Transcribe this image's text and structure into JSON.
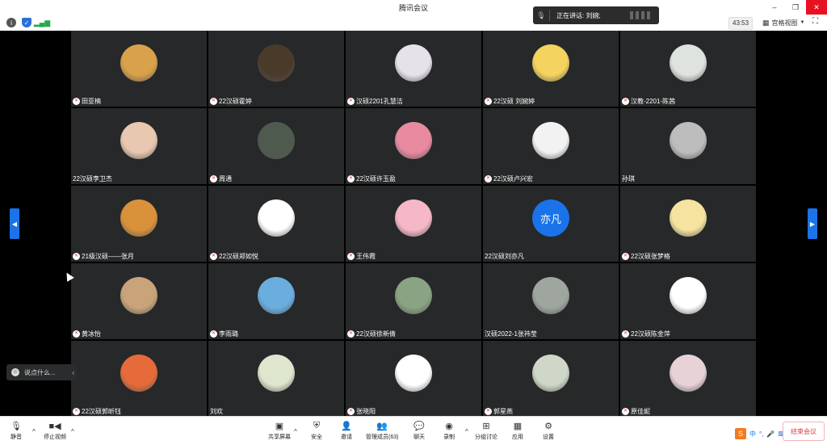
{
  "window": {
    "title": "腾讯会议"
  },
  "window_controls": [
    "–",
    "❐",
    "✕"
  ],
  "topbar": {
    "timer": "43:53",
    "view_label": "宫格视图"
  },
  "speaking": {
    "label": "正在讲话: 刘婉;"
  },
  "participants": [
    {
      "name": "田亚楠",
      "avatar": "cartoon-lion",
      "color": "#d9a24a"
    },
    {
      "name": "22汉硕霍婷",
      "avatar": "dark-photo",
      "color": "#4a3a2a"
    },
    {
      "name": "汉硕2201孔慧洁",
      "avatar": "girl-photo",
      "color": "#e6e2ea"
    },
    {
      "name": "22汉硕 刘婉婷",
      "avatar": "cartoon-duck",
      "color": "#f4d35e"
    },
    {
      "name": "汉教-2201-陈茜",
      "avatar": "girl-photo",
      "color": "#dfe3df"
    },
    {
      "name": "22汉硕李卫杰",
      "avatar": "drawing",
      "color": "#e8c8b0"
    },
    {
      "name": "周通",
      "avatar": "man-photo",
      "color": "#4e5a4e"
    },
    {
      "name": "22汉硕许玉盈",
      "avatar": "girl-pink",
      "color": "#e98aa0"
    },
    {
      "name": "22汉硕卢兴宏",
      "avatar": "flower",
      "color": "#f2f2f2"
    },
    {
      "name": "孙琪",
      "avatar": "match",
      "color": "#bdbdbd"
    },
    {
      "name": "21级汉硕——张月",
      "avatar": "bread",
      "color": "#d9923a"
    },
    {
      "name": "22汉硕郑如悦",
      "avatar": "cartoon-dog",
      "color": "#ffffff"
    },
    {
      "name": "王伟霞",
      "avatar": "cartoon-pig",
      "color": "#f6b8c8"
    },
    {
      "name": "22汉硕刘亦凡",
      "avatar": "text",
      "avatar_text": "亦凡",
      "color": "#1a73e8"
    },
    {
      "name": "22汉硕张梦格",
      "avatar": "cartoon-princess",
      "color": "#f6e3a0"
    },
    {
      "name": "黄冰怡",
      "avatar": "child-photo",
      "color": "#c9a47a"
    },
    {
      "name": "李雨璐",
      "avatar": "blue-sky",
      "color": "#6aaee0"
    },
    {
      "name": "22汉硕徐新倩",
      "avatar": "girl-green",
      "color": "#8aa382"
    },
    {
      "name": "汉硕2022-1张祎莹",
      "avatar": "bicycle",
      "color": "#9fa6a0"
    },
    {
      "name": "22汉硕陈金萍",
      "avatar": "cartoon-girl",
      "color": "#ffffff"
    },
    {
      "name": "22汉硕郭昕钰",
      "avatar": "cartoon-kids",
      "color": "#e76b3a"
    },
    {
      "name": "刘欢",
      "avatar": "flowers",
      "color": "#dfe6ce"
    },
    {
      "name": "张晓阳",
      "avatar": "orange",
      "color": "#ffffff"
    },
    {
      "name": "郭星燕",
      "avatar": "tulips",
      "color": "#cfd8c8"
    },
    {
      "name": "原佳妮",
      "avatar": "beach-girl",
      "color": "#e7d2d8"
    }
  ],
  "muted_badge": {
    "show": [
      true,
      true,
      true,
      true,
      true,
      false,
      true,
      true,
      true,
      false,
      true,
      true,
      true,
      false,
      true,
      true,
      true,
      true,
      false,
      true,
      true,
      false,
      true,
      true,
      true
    ]
  },
  "chat_input": {
    "placeholder": "说点什么..."
  },
  "toolbar": {
    "mute": "静音",
    "stop_video": "停止视频",
    "share_screen": "共享屏幕",
    "security": "安全",
    "invite": "邀请",
    "manage_members": "管理成员(63)",
    "chat": "聊天",
    "record": "录制",
    "breakout": "分组讨论",
    "apps": "应用",
    "settings": "设置",
    "end_meeting": "结束会议"
  },
  "ime": {
    "logo": "S",
    "items": [
      "中",
      "°,",
      "🎤",
      "⌨",
      "👕",
      "▦"
    ]
  }
}
